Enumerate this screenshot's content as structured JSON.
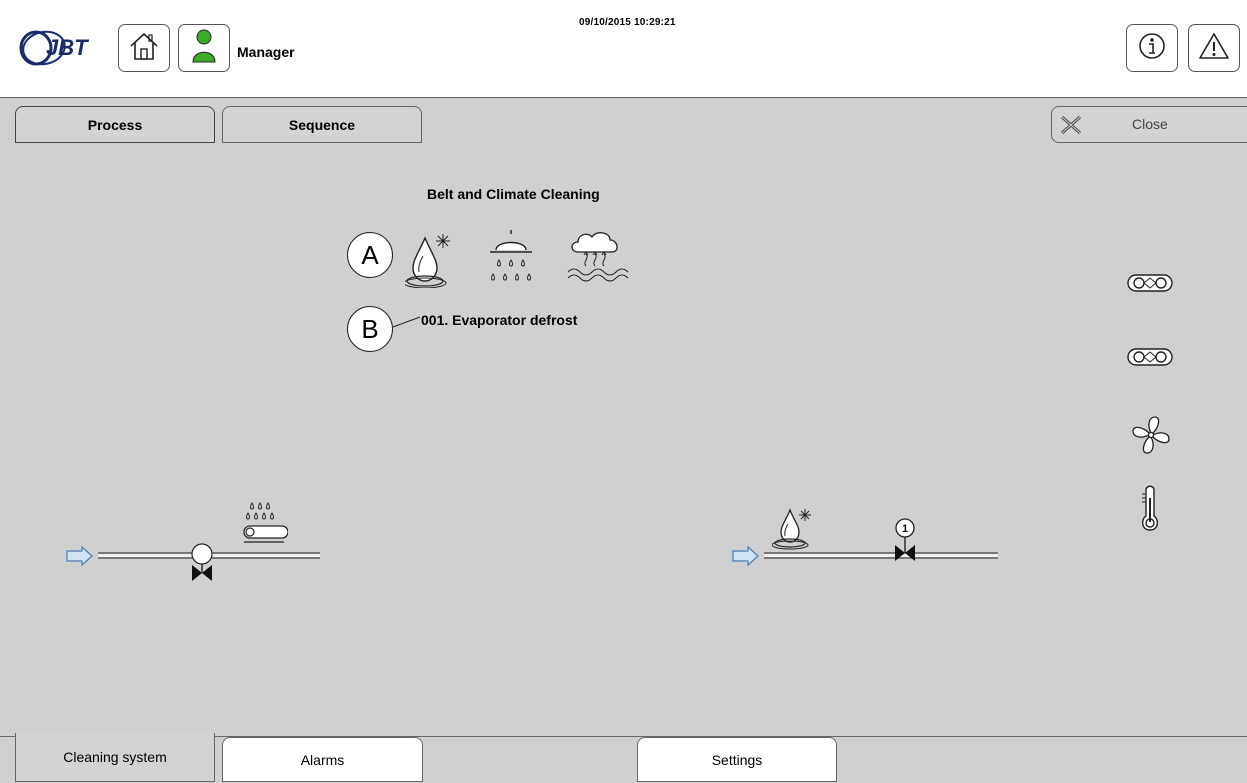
{
  "header": {
    "brand": "JBT",
    "datetime": "09/10/2015 10:29:21",
    "user": "Manager",
    "icons": [
      "home-icon",
      "user-icon",
      "info-icon",
      "warning-icon"
    ]
  },
  "top_tabs": [
    {
      "label": "Process",
      "active": true
    },
    {
      "label": "Sequence",
      "active": false
    }
  ],
  "close": {
    "label": "Close",
    "icon": "close-icon"
  },
  "process": {
    "title": "Belt and Climate Cleaning",
    "callout_a": "A",
    "callout_b": "B",
    "step": "001. Evaporator defrost",
    "step_icons": [
      "defrost-drop-icon",
      "shower-icon",
      "steam-cloud-icon"
    ],
    "valve_number": "1",
    "status_icons": [
      "belt-drive-icon",
      "belt-drive-icon",
      "fan-icon",
      "thermometer-icon"
    ]
  },
  "bottom_tabs": [
    {
      "label": "Cleaning system",
      "active": true
    },
    {
      "label": "Alarms",
      "active": false
    },
    {
      "label": "Settings",
      "active": false
    }
  ],
  "colors": {
    "background": "#d0d0d0",
    "accent_user": "#3daa2a",
    "flow_arrow": "#9fc0e0"
  }
}
